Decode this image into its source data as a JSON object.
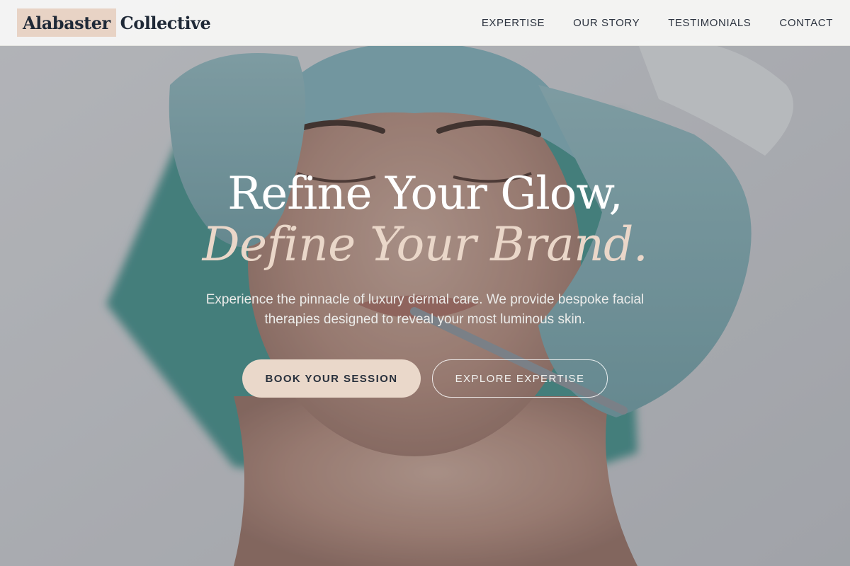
{
  "brand": {
    "logo_highlight": "Alabaster",
    "logo_rest": "Collective"
  },
  "nav": {
    "items": [
      {
        "label": "EXPERTISE"
      },
      {
        "label": "OUR STORY"
      },
      {
        "label": "TESTIMONIALS"
      },
      {
        "label": "CONTACT"
      }
    ]
  },
  "hero": {
    "headline_line1": "Refine Your Glow,",
    "headline_line2": "Define Your Brand.",
    "subtext": "Experience the pinnacle of luxury dermal care. We provide bespoke facial therapies designed to reveal your most luminous skin.",
    "primary_cta": "BOOK YOUR SESSION",
    "secondary_cta": "EXPLORE EXPERTISE"
  },
  "colors": {
    "accent": "#ead8ca",
    "header_bg": "#f7f7f5",
    "text_dark": "#1f2937"
  }
}
